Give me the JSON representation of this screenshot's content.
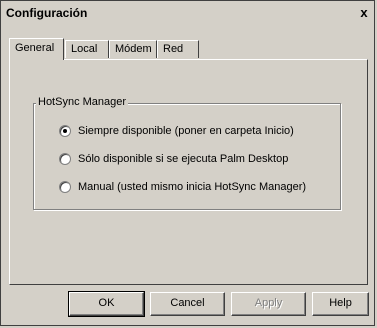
{
  "window": {
    "title": "Configuración",
    "close_label": "x"
  },
  "tabs": [
    {
      "label": "General",
      "active": true
    },
    {
      "label": "Local",
      "active": false
    },
    {
      "label": "Módem",
      "active": false
    },
    {
      "label": "Red",
      "active": false
    }
  ],
  "group": {
    "label": "HotSync Manager",
    "options": [
      {
        "label": "Siempre disponible (poner en carpeta Inicio)",
        "checked": true
      },
      {
        "label": "Sólo disponible si se ejecuta Palm Desktop",
        "checked": false
      },
      {
        "label": "Manual (usted mismo inicia HotSync Manager)",
        "checked": false
      }
    ]
  },
  "buttons": {
    "ok": "OK",
    "cancel": "Cancel",
    "apply": "Apply",
    "help": "Help"
  }
}
